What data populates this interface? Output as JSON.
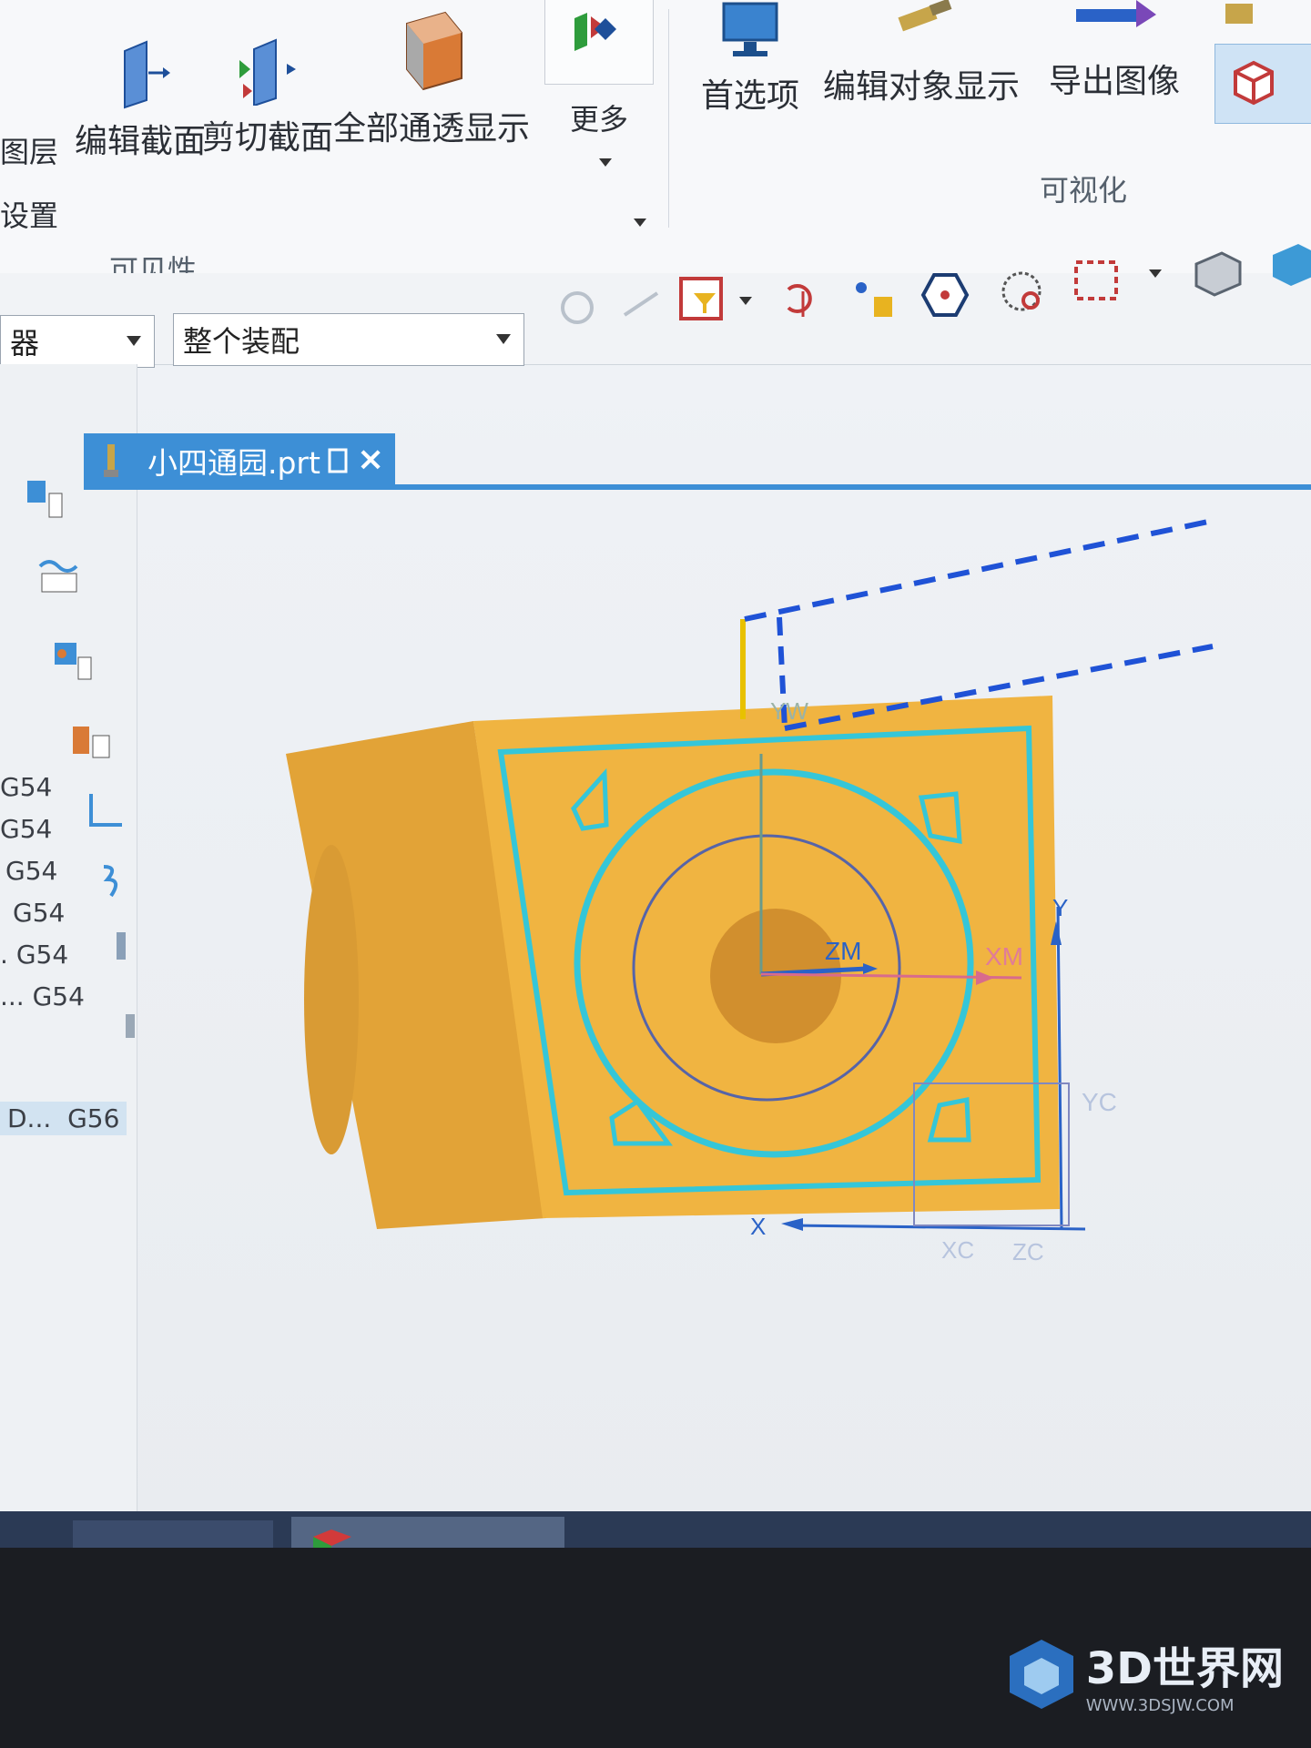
{
  "ribbon": {
    "layer_label": "图层",
    "settings_label": "设置",
    "edit_section_label": "编辑截面",
    "clip_section_label": "剪切截面",
    "show_all_label": "全部通透显示",
    "more_label": "更多",
    "visibility_group": "可见性",
    "preferences_label": "首选项",
    "edit_object_display_label": "编辑对象显示",
    "export_image_label": "导出图像",
    "visualization_group": "可视化"
  },
  "toolbar": {
    "filter_value": "器",
    "assembly_value": "整个装配"
  },
  "tab": {
    "title": "小四通园.prt"
  },
  "navigator": {
    "items": [
      "G54",
      "G54",
      "G54",
      "G54",
      "G54",
      "G54"
    ],
    "item_prefix_5": ".",
    "item_prefix_6": "...",
    "last_item_prefix": "D...",
    "last_item": "G56"
  },
  "viewport_labels": {
    "yw": "YW",
    "zm": "ZM",
    "xm": "XM",
    "y": "Y",
    "yc": "YC",
    "x": "X",
    "xc": "XC",
    "zc": "ZC"
  },
  "watermark": {
    "brand": "3D世界网",
    "url": "WWW.3DSJW.COM"
  },
  "colors": {
    "part": "#f0b441",
    "part_side": "#e2a337",
    "cyan_edge": "#35c6d8",
    "tab": "#3d8fd6",
    "dashed": "#1f52d6"
  }
}
